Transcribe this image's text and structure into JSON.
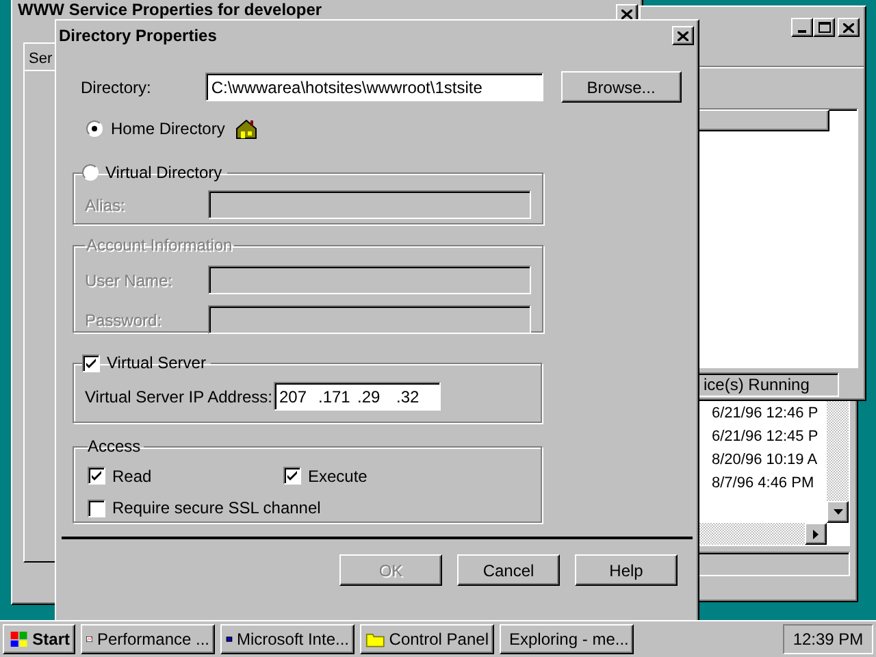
{
  "background_windows": {
    "service_properties": {
      "title": "WWW Service Properties for developer",
      "tab": "Ser"
    },
    "service_manager": {
      "status": "ice(s) Running"
    },
    "explorer": {
      "rows": [
        "6/21/96 12:46 P",
        "6/21/96 12:45 P",
        "8/20/96 10:19 A",
        "8/7/96 4:46 PM"
      ]
    }
  },
  "dialog": {
    "title": "Directory Properties",
    "directory": {
      "label": "Directory:",
      "value": "C:\\wwwarea\\hotsites\\wwwroot\\1stsite",
      "button": "Browse..."
    },
    "home_directory": {
      "label": "Home Directory",
      "selected": true
    },
    "virtual_directory": {
      "label": "Virtual Directory",
      "selected": false,
      "alias": {
        "label": "Alias:",
        "disabled": true
      }
    },
    "account_information": {
      "title": "Account Information",
      "disabled": true,
      "fields": [
        {
          "label": "User Name:"
        },
        {
          "label": "Password:"
        }
      ]
    },
    "virtual_server": {
      "label": "Virtual Server",
      "checked": true,
      "ip_label": "Virtual Server IP Address:",
      "ip": [
        "207",
        ".171",
        ".29",
        ".32"
      ]
    },
    "access": {
      "title": "Access",
      "options": [
        {
          "label": "Read",
          "checked": true
        },
        {
          "label": "Execute",
          "checked": true
        },
        {
          "label": "Require secure SSL channel",
          "checked": false
        }
      ]
    },
    "buttons": [
      {
        "label": "OK",
        "disabled": true
      },
      {
        "label": "Cancel",
        "disabled": false
      },
      {
        "label": "Help",
        "disabled": false
      }
    ]
  },
  "taskbar": {
    "start": "Start",
    "items": [
      {
        "label": "Performance ...",
        "selected": false
      },
      {
        "label": "Microsoft Inte...",
        "selected": false
      },
      {
        "label": "Control Panel",
        "selected": false
      },
      {
        "label": "Exploring - me...",
        "selected": false
      }
    ],
    "clock": "12:39 PM"
  }
}
